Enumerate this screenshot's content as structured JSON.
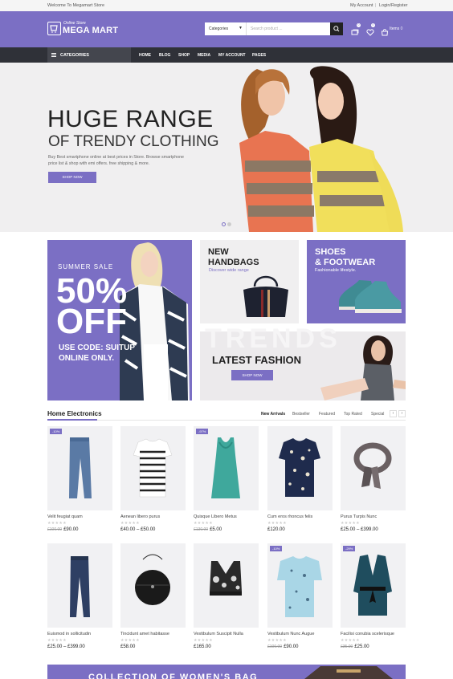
{
  "topbar": {
    "welcome": "Welcome To Megamart Store",
    "my_account": "My Account",
    "login": "Login/Register"
  },
  "header": {
    "logo_small": "Online Store",
    "logo_big": "MEGA MART",
    "category_select": "Categories",
    "search_placeholder": "Search product ...",
    "compare_count": "0",
    "wishlist_count": "0",
    "cart_label": "Items",
    "cart_count": "0"
  },
  "nav": {
    "categories_label": "CATEGORIES",
    "items": [
      "HOME",
      "BLOG",
      "SHOP",
      "MEDIA",
      "MY ACCOUNT",
      "PAGES"
    ]
  },
  "hero": {
    "title_line1": "HUGE RANGE",
    "title_line2": "OF TRENDY CLOTHING",
    "description": "Buy Best smartphone online at best prices in Store. Browse smartphone price list & shop with emi offers. free shipping & more.",
    "button": "SHOP NOW",
    "slides_active": 1
  },
  "promos": {
    "sale": {
      "small": "SUMMER SALE",
      "big1": "50%",
      "big2": "OFF",
      "code1": "USE CODE: SUITUP",
      "code2": "ONLINE ONLY."
    },
    "handbags": {
      "title1": "NEW",
      "title2": "HANDBAGS",
      "subtitle": "Discover wide range"
    },
    "shoes": {
      "title1": "SHOES",
      "title2": "& FOOTWEAR",
      "subtitle": "Fashionable lifestyle."
    },
    "fashion": {
      "watermark": "TRENDS",
      "title": "LATEST FASHION",
      "button": "SHOP NOW"
    }
  },
  "products": {
    "section_title": "Home Electronics",
    "tabs": [
      "New Arrivals",
      "Bestseller",
      "Featured",
      "Top Rated",
      "Special"
    ],
    "prev": "‹",
    "next": "›",
    "items": [
      {
        "name": "Velit feugiat quam",
        "old": "£100.00",
        "price": "£90.00",
        "badge": "-10%"
      },
      {
        "name": "Aenean libero purus",
        "old": "",
        "price": "£40.00 – £50.00",
        "badge": ""
      },
      {
        "name": "Quisque Libero Metus",
        "old": "£130.00",
        "price": "£5.00",
        "badge": "-97%"
      },
      {
        "name": "Cum eros rhoncus felis",
        "old": "",
        "price": "£120.00",
        "badge": ""
      },
      {
        "name": "Purus Turpis Nunc",
        "old": "",
        "price": "£25.00 – £399.00",
        "badge": ""
      },
      {
        "name": "Euismod in sollicitudin",
        "old": "",
        "price": "£25.00 – £399.00",
        "badge": ""
      },
      {
        "name": "Tincidunt amet habitasse",
        "old": "",
        "price": "£58.00",
        "badge": ""
      },
      {
        "name": "Vestibulum Suscipit Nulla",
        "old": "",
        "price": "£165.00",
        "badge": ""
      },
      {
        "name": "Vestibulum Nunc Augue",
        "old": "£100.00",
        "price": "£90.00",
        "badge": "-10%"
      },
      {
        "name": "Facilisi conubia scelerisque",
        "old": "£35.00",
        "price": "£25.00",
        "badge": "-29%"
      }
    ]
  },
  "bottom_banner": {
    "text": "COLLECTION OF WOMEN'S BAG"
  },
  "colors": {
    "accent": "#7b6fc4",
    "nav": "#2f3138",
    "hero_bg": "#f0eff0"
  }
}
